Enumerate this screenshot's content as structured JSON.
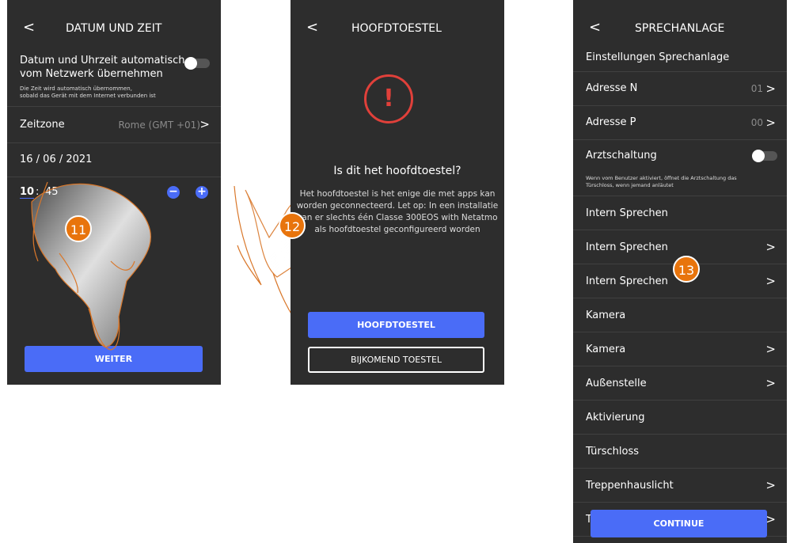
{
  "screen1": {
    "title": "DATUM UND ZEIT",
    "back": "<",
    "auto_label_1": "Datum und Uhrzeit automatisch",
    "auto_label_2": "vom Netzwerk übernehmen",
    "auto_hint_1": "Die Zeit wird automatisch übernommen,",
    "auto_hint_2": "sobald das Gerät mit dem Internet verbunden ist",
    "timezone_label": "Zeitzone",
    "timezone_value": "Rome (GMT +01)",
    "date": "16 / 06 / 2021",
    "hour": "10",
    "colon": ":",
    "minute": "45",
    "minus": "−",
    "plus": "+",
    "button": "WEITER",
    "step": "11"
  },
  "screen2": {
    "title": "HOOFDTOESTEL",
    "back": "<",
    "warning_glyph": "!",
    "question": "Is dit het hoofdtoestel?",
    "desc": [
      "Het hoofdtoestel is het enige die met apps kan",
      "worden geconnecteerd. Let op: In een installatie",
      "kan er slechts één Classe 300EOS with Netatmo",
      "als hoofdtoestel geconfigureerd worden"
    ],
    "primary_button": "HOOFDTOESTEL",
    "secondary_button": "BIJKOMEND TOESTEL",
    "step": "12"
  },
  "screen3": {
    "title": "SPRECHANLAGE",
    "back": "<",
    "section": "Einstellungen Sprechanlage",
    "addr_n_label": "Adresse N",
    "addr_n_value": "01",
    "addr_p_label": "Adresse P",
    "addr_p_value": "00",
    "arzt_label": "Arztschaltung",
    "arzt_hint_1": "Wenn vom Benutzer aktiviert, öffnet die Arztschaltung das",
    "arzt_hint_2": "Türschloss, wenn jemand anläutet",
    "items": [
      "Intern Sprechen",
      "Intern Sprechen",
      "Intern Sprechen",
      "Kamera",
      "Kamera",
      "Außenstelle",
      "Aktivierung",
      "Türschloss",
      "Treppenhauslicht",
      "T"
    ],
    "button": "CONTINUE",
    "step": "13"
  },
  "colors": {
    "screen_bg": "#2d2d2d",
    "accent": "#4a6cf7",
    "badge": "#e8740c",
    "warning": "#e0403a"
  },
  "icons": [
    "chevron-left-icon",
    "chevron-right-icon",
    "toggle-switch",
    "warning-circle-icon",
    "minus-circle-icon",
    "plus-circle-icon",
    "pointing-hand"
  ]
}
